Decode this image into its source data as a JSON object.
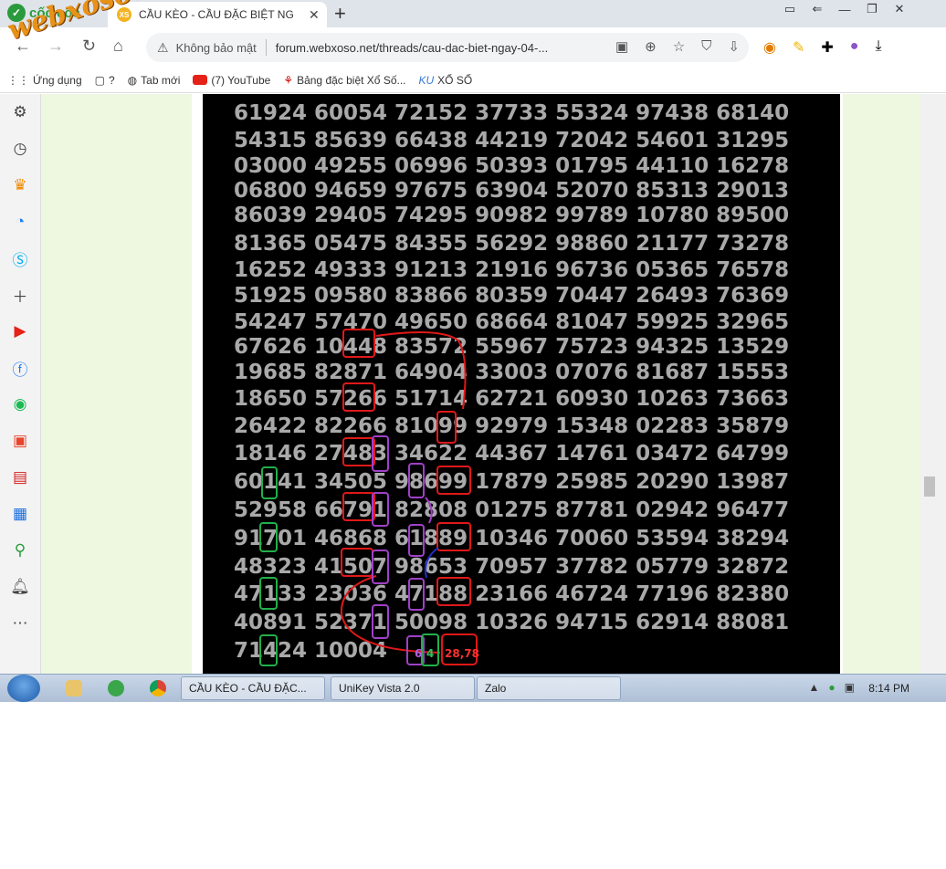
{
  "browser": {
    "brand": "cốc cốc",
    "tab_title": "CẦU KÈO - CẦU ĐẶC BIỆT NG",
    "new_tab": "+",
    "security": "Không bảo mật",
    "url": "forum.webxoso.net/threads/cau-dac-biet-ngay-04-...",
    "watermark": "webxoso.net"
  },
  "bookmarks": [
    {
      "label": "Ứng dụng"
    },
    {
      "label": "?"
    },
    {
      "label": "Tab mới"
    },
    {
      "label": "(7) YouTube"
    },
    {
      "label": "Bảng đặc biệt Xổ Số..."
    },
    {
      "label": "XỔ SỐ"
    }
  ],
  "rows": [
    "61924 60054 72152 37733 55324 97438 68140",
    "54315 85639 66438 44219 72042 54601 31295",
    "03000 49255 06996 50393 01795 44110 16278",
    "06800 94659 97675 63904 52070 85313 29013",
    "86039 29405 74295 90982 99789 10780 89500",
    "81365 05475 84355 56292 98860 21177 73278",
    "16252 49333 91213 21916 96736 05365 76578",
    "51925 09580 83866 80359 70447 26493 76369",
    "54247 57470 49650 68664 81047 59925 32965",
    "67626 10448 83572 55967 75723 94325 13529",
    "19685 82871 64904 33003 07076 81687 15553",
    "18650 57266 51714 62721 60930 10263 73663",
    "26422 82266 81099 92979 15348 02283 35879",
    "18146 27483 34622 44367 14761 03472 64799",
    "60141 34505 98699 17879 25985 20290 13987",
    "52958 66791 82808 01275 87781 02942 96477",
    "91701 46868 61889 10346 70060 53594 38294",
    "48323 41507 98653 70957 37782 05779 32872",
    "47133 23036 47188 23166 46724 77196 82380",
    "40891 52371 50098 10326 94715 62914 88081",
    "71424 10004"
  ],
  "annotations": {
    "purple_six": "6",
    "green_four": "4",
    "red_result": "28,78"
  },
  "taskbar": {
    "tasks": [
      "CẦU KÈO - CẦU ĐẶC...",
      "UniKey Vista 2.0",
      "Zalo"
    ],
    "clock": "8:14 PM"
  }
}
